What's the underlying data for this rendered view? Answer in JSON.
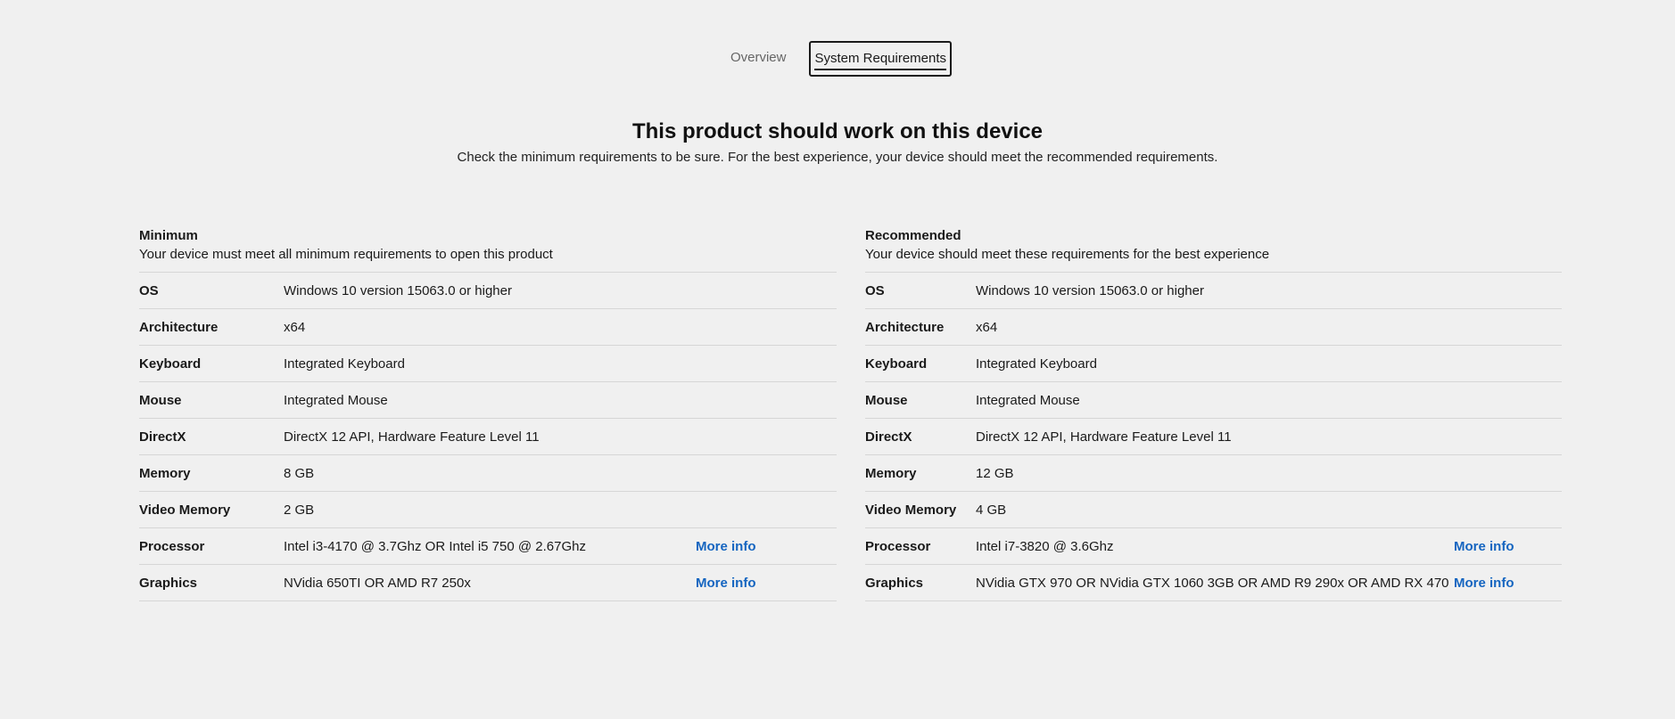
{
  "tabs": {
    "overview": "Overview",
    "system_requirements": "System Requirements"
  },
  "header": {
    "title": "This product should work on this device",
    "subtitle": "Check the minimum requirements to be sure. For the best experience, your device should meet the recommended requirements."
  },
  "minimum": {
    "title": "Minimum",
    "description": "Your device must meet all minimum requirements to open this product",
    "rows": [
      {
        "label": "OS",
        "value": "Windows 10 version 15063.0 or higher"
      },
      {
        "label": "Architecture",
        "value": "x64"
      },
      {
        "label": "Keyboard",
        "value": "Integrated Keyboard"
      },
      {
        "label": "Mouse",
        "value": "Integrated Mouse"
      },
      {
        "label": "DirectX",
        "value": "DirectX 12 API, Hardware Feature Level 11"
      },
      {
        "label": "Memory",
        "value": "8 GB"
      },
      {
        "label": "Video Memory",
        "value": "2 GB"
      },
      {
        "label": "Processor",
        "value": "Intel i3-4170 @ 3.7Ghz OR Intel i5 750 @ 2.67Ghz",
        "link": "More info"
      },
      {
        "label": "Graphics",
        "value": "NVidia 650TI OR AMD R7 250x",
        "link": "More info"
      }
    ]
  },
  "recommended": {
    "title": "Recommended",
    "description": "Your device should meet these requirements for the best experience",
    "rows": [
      {
        "label": "OS",
        "value": "Windows 10 version 15063.0 or higher"
      },
      {
        "label": "Architecture",
        "value": "x64"
      },
      {
        "label": "Keyboard",
        "value": "Integrated Keyboard"
      },
      {
        "label": "Mouse",
        "value": "Integrated Mouse"
      },
      {
        "label": "DirectX",
        "value": "DirectX 12 API, Hardware Feature Level 11"
      },
      {
        "label": "Memory",
        "value": "12 GB"
      },
      {
        "label": "Video Memory",
        "value": "4 GB"
      },
      {
        "label": "Processor",
        "value": "Intel i7-3820 @ 3.6Ghz",
        "link": "More info"
      },
      {
        "label": "Graphics",
        "value": "NVidia GTX 970 OR NVidia GTX 1060 3GB OR AMD R9 290x OR AMD RX 470",
        "link": "More info"
      }
    ]
  },
  "colors": {
    "background": "#f0f0f0",
    "link": "#1565c0",
    "divider": "#d6d6d6"
  }
}
